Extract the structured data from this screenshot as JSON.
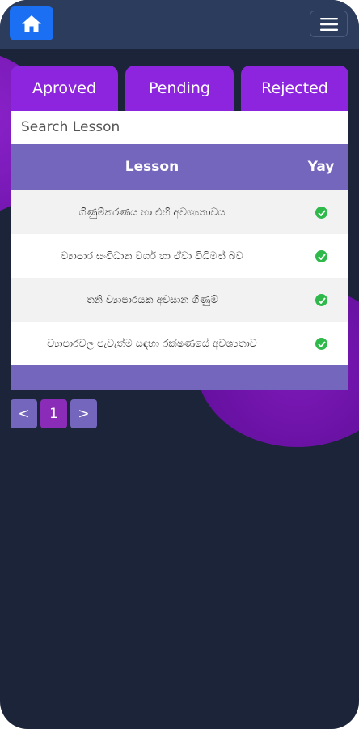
{
  "header": {
    "home_icon": "home-icon",
    "menu_icon": "hamburger-menu-icon"
  },
  "tabs": [
    {
      "label": "Aproved"
    },
    {
      "label": "Pending"
    },
    {
      "label": "Rejected"
    }
  ],
  "search": {
    "placeholder": "Search Lesson"
  },
  "table": {
    "columns": {
      "lesson": "Lesson",
      "status": "Yay"
    },
    "rows": [
      {
        "lesson": "ගිණුම්කරණය හා එහි අවශ්‍යතාවය",
        "status_icon": "check-circle-icon"
      },
      {
        "lesson": "ව්‍යාපාර සංවිධාන වර්ග හා ඒවා විධිමත් බව",
        "status_icon": "check-circle-icon"
      },
      {
        "lesson": "තනි ව්‍යාපාරයක අවසාන ගිණුම්",
        "status_icon": "check-circle-icon"
      },
      {
        "lesson": "ව්‍යාපාරවල පැවැත්ම සඳහා රක්ෂණයේ අවශ්‍යතාව",
        "status_icon": "check-circle-icon"
      }
    ]
  },
  "pagination": {
    "prev_label": "<",
    "current_page": "1",
    "next_label": ">"
  },
  "colors": {
    "background": "#1b2438",
    "header": "#2b3c5c",
    "home_button": "#1a6ff3",
    "tab": "#8c25dd",
    "table_header": "#7466bd",
    "check": "#2eb94a",
    "current_page": "#8a2cb8"
  }
}
